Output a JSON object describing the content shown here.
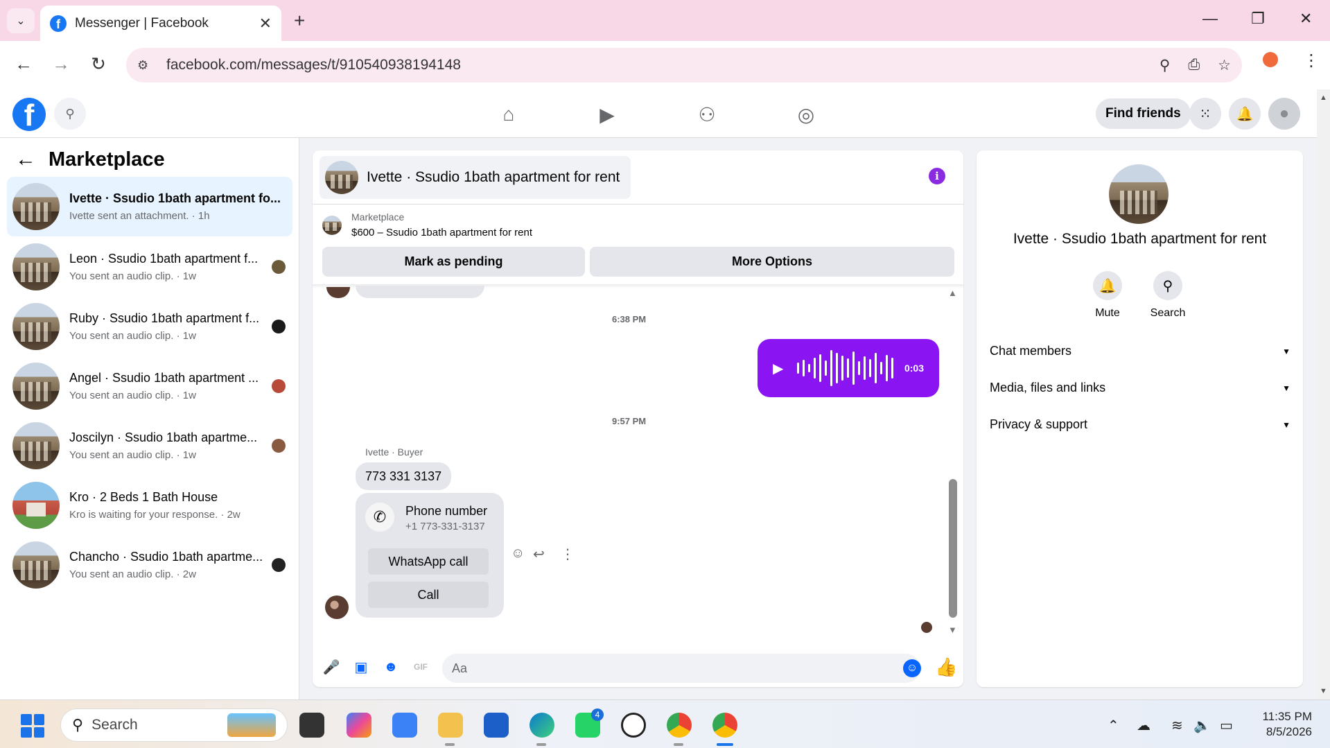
{
  "browser": {
    "tab_title": "Messenger | Facebook",
    "url": "facebook.com/messages/t/910540938194148"
  },
  "header": {
    "find_friends": "Find friends"
  },
  "sidebar": {
    "title": "Marketplace",
    "conversations": [
      {
        "name": "Ivette · Ssudio 1bath apartment fo...",
        "sub": "Ivette sent an attachment. · 1h"
      },
      {
        "name": "Leon · Ssudio 1bath apartment f...",
        "sub": "You sent an audio clip. · 1w"
      },
      {
        "name": "Ruby · Ssudio 1bath apartment f...",
        "sub": "You sent an audio clip. · 1w"
      },
      {
        "name": "Angel · Ssudio 1bath apartment ...",
        "sub": "You sent an audio clip. · 1w"
      },
      {
        "name": "Joscilyn · Ssudio 1bath apartme...",
        "sub": "You sent an audio clip. · 1w"
      },
      {
        "name": "Kro · 2 Beds 1 Bath House",
        "sub": "Kro is waiting for your response. · 2w"
      },
      {
        "name": "Chancho · Ssudio 1bath apartme...",
        "sub": "You sent an audio clip. · 2w"
      }
    ]
  },
  "chat": {
    "title": "Ivette · Ssudio 1bath apartment for rent",
    "marketplace_label": "Marketplace",
    "listing": "$600 – Ssudio 1bath apartment for rent",
    "mark_pending": "Mark as pending",
    "more_options": "More Options",
    "time1": "6:38 PM",
    "audio_duration": "0:03",
    "time2": "9:57 PM",
    "sender": "Ivette · Buyer",
    "phone_text": "773 331 3137",
    "card_title": "Phone number",
    "card_number": "+1 773-331-3137",
    "whatsapp_call": "WhatsApp call",
    "call": "Call",
    "composer_placeholder": "Aa"
  },
  "info": {
    "name": "Ivette · Ssudio 1bath apartment for rent",
    "mute": "Mute",
    "search": "Search",
    "sections": [
      "Chat members",
      "Media, files and links",
      "Privacy & support"
    ]
  },
  "taskbar": {
    "search_placeholder": "Search",
    "whatsapp_badge": "4",
    "time": "11:35 PM",
    "date": "8/5/2026"
  },
  "colors": {
    "fb_blue": "#1877f2",
    "messenger_purple": "#8a14f2",
    "active_conv": "#e7f3ff"
  }
}
